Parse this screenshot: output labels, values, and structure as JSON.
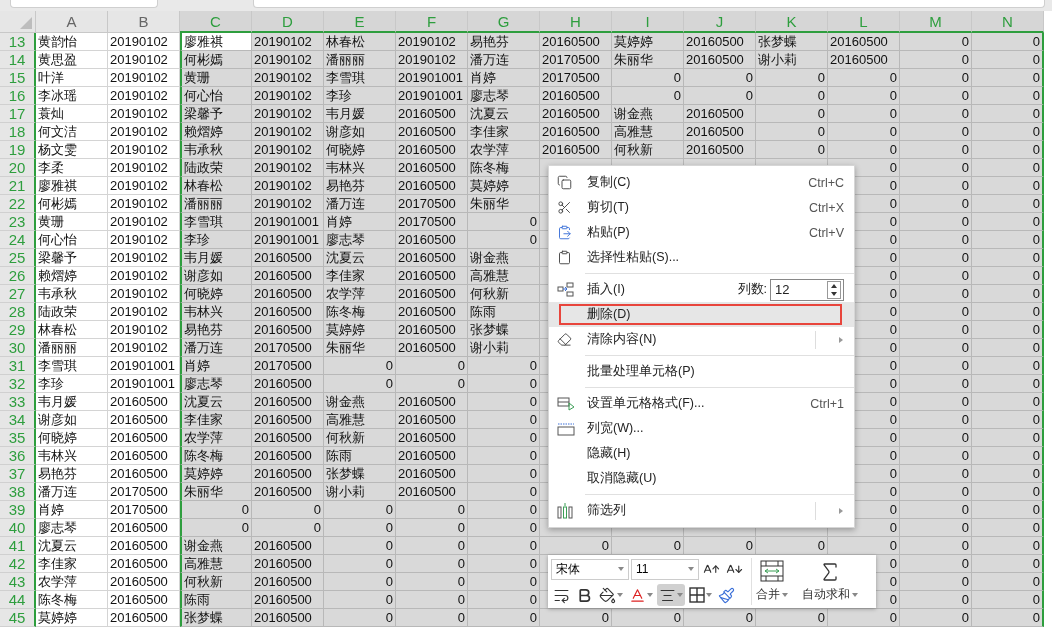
{
  "columns": [
    {
      "label": "A",
      "selected": false
    },
    {
      "label": "B",
      "selected": false
    },
    {
      "label": "C",
      "selected": true
    },
    {
      "label": "D",
      "selected": true
    },
    {
      "label": "E",
      "selected": true
    },
    {
      "label": "F",
      "selected": true
    },
    {
      "label": "G",
      "selected": true
    },
    {
      "label": "H",
      "selected": true
    },
    {
      "label": "I",
      "selected": true
    },
    {
      "label": "J",
      "selected": true
    },
    {
      "label": "K",
      "selected": true
    },
    {
      "label": "L",
      "selected": true
    },
    {
      "label": "M",
      "selected": true
    },
    {
      "label": "N",
      "selected": true
    }
  ],
  "rows": [
    {
      "n": "13",
      "cells": [
        "黄韵怡",
        "20190102",
        {
          "text": "廖雅祺",
          "active": true
        },
        "20190102",
        "林春松",
        "20190102",
        "易艳芬",
        "20160500",
        "莫婷婷",
        "20160500",
        "张梦蝶",
        "20160500",
        {
          "number": "0"
        },
        {
          "number": "0"
        }
      ]
    },
    {
      "n": "14",
      "cells": [
        "黄思盈",
        "20190102",
        "何彬嫣",
        "20190102",
        "潘丽丽",
        "20190102",
        "潘万连",
        "20170500",
        "朱丽华",
        "20160500",
        "谢小莉",
        "20160500",
        {
          "number": "0"
        },
        {
          "number": "0"
        }
      ]
    },
    {
      "n": "15",
      "cells": [
        "叶洋",
        "20190102",
        "黄珊",
        "20190102",
        "李雪琪",
        "201901001",
        "肖婷",
        "20170500",
        {
          "number": "0"
        },
        {
          "number": "0"
        },
        {
          "number": "0"
        },
        {
          "number": "0"
        },
        {
          "number": "0"
        },
        {
          "number": "0"
        }
      ]
    },
    {
      "n": "16",
      "cells": [
        "李冰瑶",
        "20190102",
        "何心怡",
        "20190102",
        "李珍",
        "201901001",
        "廖志琴",
        "20160500",
        {
          "number": "0"
        },
        {
          "number": "0"
        },
        {
          "number": "0"
        },
        {
          "number": "0"
        },
        {
          "number": "0"
        },
        {
          "number": "0"
        }
      ]
    },
    {
      "n": "17",
      "cells": [
        "蓑灿",
        "20190102",
        "梁馨予",
        "20190102",
        "韦月媛",
        "20160500",
        "沈夏云",
        "20160500",
        "谢金燕",
        "20160500",
        {
          "number": "0"
        },
        {
          "number": "0"
        },
        {
          "number": "0"
        },
        {
          "number": "0"
        }
      ]
    },
    {
      "n": "18",
      "cells": [
        "何文洁",
        "20190102",
        "赖熠婷",
        "20190102",
        "谢彦如",
        "20160500",
        "李佳家",
        "20160500",
        "高雅慧",
        "20160500",
        {
          "number": "0"
        },
        {
          "number": "0"
        },
        {
          "number": "0"
        },
        {
          "number": "0"
        }
      ]
    },
    {
      "n": "19",
      "cells": [
        "杨文雯",
        "20190102",
        "韦承秋",
        "20190102",
        "何晓婷",
        "20160500",
        "农学萍",
        "20160500",
        "何秋新",
        "20160500",
        {
          "number": "0"
        },
        {
          "number": "0"
        },
        {
          "number": "0"
        },
        {
          "number": "0"
        }
      ]
    },
    {
      "n": "20",
      "cells": [
        "李柔",
        "20190102",
        "陆政荣",
        "20190102",
        "韦林兴",
        "20160500",
        "陈冬梅",
        null,
        null,
        null,
        null,
        {
          "number": "0"
        },
        {
          "number": "0"
        },
        {
          "number": "0"
        }
      ]
    },
    {
      "n": "21",
      "cells": [
        "廖雅祺",
        "20190102",
        "林春松",
        "20190102",
        "易艳芬",
        "20160500",
        "莫婷婷",
        null,
        null,
        null,
        null,
        {
          "number": "0"
        },
        {
          "number": "0"
        },
        {
          "number": "0"
        }
      ]
    },
    {
      "n": "22",
      "cells": [
        "何彬嫣",
        "20190102",
        "潘丽丽",
        "20190102",
        "潘万连",
        "20170500",
        "朱丽华",
        null,
        null,
        null,
        null,
        {
          "number": "0"
        },
        {
          "number": "0"
        },
        {
          "number": "0"
        }
      ]
    },
    {
      "n": "23",
      "cells": [
        "黄珊",
        "20190102",
        "李雪琪",
        "201901001",
        "肖婷",
        "20170500",
        {
          "number": "0"
        },
        null,
        null,
        null,
        null,
        {
          "number": "0"
        },
        {
          "number": "0"
        },
        {
          "number": "0"
        }
      ]
    },
    {
      "n": "24",
      "cells": [
        "何心怡",
        "20190102",
        "李珍",
        "201901001",
        "廖志琴",
        "20160500",
        {
          "number": "0"
        },
        null,
        null,
        null,
        null,
        {
          "number": "0"
        },
        {
          "number": "0"
        },
        {
          "number": "0"
        }
      ]
    },
    {
      "n": "25",
      "cells": [
        "梁馨予",
        "20190102",
        "韦月媛",
        "20160500",
        "沈夏云",
        "20160500",
        "谢金燕",
        null,
        null,
        null,
        null,
        {
          "number": "0"
        },
        {
          "number": "0"
        },
        {
          "number": "0"
        }
      ]
    },
    {
      "n": "26",
      "cells": [
        "赖熠婷",
        "20190102",
        "谢彦如",
        "20160500",
        "李佳家",
        "20160500",
        "高雅慧",
        null,
        null,
        null,
        null,
        {
          "number": "0"
        },
        {
          "number": "0"
        },
        {
          "number": "0"
        }
      ]
    },
    {
      "n": "27",
      "cells": [
        "韦承秋",
        "20190102",
        "何晓婷",
        "20160500",
        "农学萍",
        "20160500",
        "何秋新",
        null,
        null,
        null,
        null,
        {
          "number": "0"
        },
        {
          "number": "0"
        },
        {
          "number": "0"
        }
      ]
    },
    {
      "n": "28",
      "cells": [
        "陆政荣",
        "20190102",
        "韦林兴",
        "20160500",
        "陈冬梅",
        "20160500",
        "陈雨",
        null,
        null,
        null,
        null,
        {
          "number": "0"
        },
        {
          "number": "0"
        },
        {
          "number": "0"
        }
      ]
    },
    {
      "n": "29",
      "cells": [
        "林春松",
        "20190102",
        "易艳芬",
        "20160500",
        "莫婷婷",
        "20160500",
        "张梦蝶",
        null,
        null,
        null,
        null,
        {
          "number": "0"
        },
        {
          "number": "0"
        },
        {
          "number": "0"
        }
      ]
    },
    {
      "n": "30",
      "cells": [
        "潘丽丽",
        "20190102",
        "潘万连",
        "20170500",
        "朱丽华",
        "20160500",
        "谢小莉",
        null,
        null,
        null,
        null,
        {
          "number": "0"
        },
        {
          "number": "0"
        },
        {
          "number": "0"
        }
      ]
    },
    {
      "n": "31",
      "cells": [
        "李雪琪",
        "201901001",
        "肖婷",
        "20170500",
        {
          "number": "0"
        },
        {
          "number": "0"
        },
        {
          "number": "0"
        },
        null,
        null,
        null,
        null,
        {
          "number": "0"
        },
        {
          "number": "0"
        },
        {
          "number": "0"
        }
      ]
    },
    {
      "n": "32",
      "cells": [
        "李珍",
        "201901001",
        "廖志琴",
        "20160500",
        {
          "number": "0"
        },
        {
          "number": "0"
        },
        {
          "number": "0"
        },
        null,
        null,
        null,
        null,
        {
          "number": "0"
        },
        {
          "number": "0"
        },
        {
          "number": "0"
        }
      ]
    },
    {
      "n": "33",
      "cells": [
        "韦月媛",
        "20160500",
        "沈夏云",
        "20160500",
        "谢金燕",
        "20160500",
        {
          "number": "0"
        },
        null,
        null,
        null,
        null,
        {
          "number": "0"
        },
        {
          "number": "0"
        },
        {
          "number": "0"
        }
      ]
    },
    {
      "n": "34",
      "cells": [
        "谢彦如",
        "20160500",
        "李佳家",
        "20160500",
        "高雅慧",
        "20160500",
        {
          "number": "0"
        },
        null,
        null,
        null,
        null,
        {
          "number": "0"
        },
        {
          "number": "0"
        },
        {
          "number": "0"
        }
      ]
    },
    {
      "n": "35",
      "cells": [
        "何晓婷",
        "20160500",
        "农学萍",
        "20160500",
        "何秋新",
        "20160500",
        {
          "number": "0"
        },
        null,
        null,
        null,
        null,
        {
          "number": "0"
        },
        {
          "number": "0"
        },
        {
          "number": "0"
        }
      ]
    },
    {
      "n": "36",
      "cells": [
        "韦林兴",
        "20160500",
        "陈冬梅",
        "20160500",
        "陈雨",
        "20160500",
        {
          "number": "0"
        },
        null,
        null,
        null,
        null,
        {
          "number": "0"
        },
        {
          "number": "0"
        },
        {
          "number": "0"
        }
      ]
    },
    {
      "n": "37",
      "cells": [
        "易艳芬",
        "20160500",
        "莫婷婷",
        "20160500",
        "张梦蝶",
        "20160500",
        {
          "number": "0"
        },
        null,
        null,
        null,
        null,
        {
          "number": "0"
        },
        {
          "number": "0"
        },
        {
          "number": "0"
        }
      ]
    },
    {
      "n": "38",
      "cells": [
        "潘万连",
        "20170500",
        "朱丽华",
        "20160500",
        "谢小莉",
        "20160500",
        {
          "number": "0"
        },
        null,
        null,
        null,
        null,
        {
          "number": "0"
        },
        {
          "number": "0"
        },
        {
          "number": "0"
        }
      ]
    },
    {
      "n": "39",
      "cells": [
        "肖婷",
        "20170500",
        {
          "number": "0"
        },
        {
          "number": "0"
        },
        {
          "number": "0"
        },
        {
          "number": "0"
        },
        {
          "number": "0"
        },
        null,
        null,
        null,
        null,
        {
          "number": "0"
        },
        {
          "number": "0"
        },
        {
          "number": "0"
        }
      ]
    },
    {
      "n": "40",
      "cells": [
        "廖志琴",
        "20160500",
        {
          "number": "0"
        },
        {
          "number": "0"
        },
        {
          "number": "0"
        },
        {
          "number": "0"
        },
        {
          "number": "0"
        },
        null,
        null,
        null,
        null,
        {
          "number": "0"
        },
        {
          "number": "0"
        },
        {
          "number": "0"
        }
      ]
    },
    {
      "n": "41",
      "cells": [
        "沈夏云",
        "20160500",
        "谢金燕",
        "20160500",
        {
          "number": "0"
        },
        {
          "number": "0"
        },
        {
          "number": "0"
        },
        {
          "number": "0"
        },
        {
          "number": "0"
        },
        {
          "number": "0"
        },
        {
          "number": "0"
        },
        {
          "number": "0"
        },
        {
          "number": "0"
        },
        {
          "number": "0"
        }
      ]
    },
    {
      "n": "42",
      "cells": [
        "李佳家",
        "20160500",
        "高雅慧",
        "20160500",
        {
          "number": "0"
        },
        {
          "number": "0"
        },
        {
          "number": "0"
        },
        null,
        null,
        null,
        null,
        {
          "number": "0"
        },
        {
          "number": "0"
        },
        {
          "number": "0"
        }
      ]
    },
    {
      "n": "43",
      "cells": [
        "农学萍",
        "20160500",
        "何秋新",
        "20160500",
        {
          "number": "0"
        },
        {
          "number": "0"
        },
        {
          "number": "0"
        },
        null,
        null,
        null,
        null,
        {
          "number": "0"
        },
        {
          "number": "0"
        },
        {
          "number": "0"
        }
      ]
    },
    {
      "n": "44",
      "cells": [
        "陈冬梅",
        "20160500",
        "陈雨",
        "20160500",
        {
          "number": "0"
        },
        {
          "number": "0"
        },
        {
          "number": "0"
        },
        null,
        null,
        null,
        null,
        {
          "number": "0"
        },
        {
          "number": "0"
        },
        {
          "number": "0"
        }
      ]
    },
    {
      "n": "45",
      "cells": [
        "莫婷婷",
        "20160500",
        "张梦蝶",
        "20160500",
        {
          "number": "0"
        },
        {
          "number": "0"
        },
        {
          "number": "0"
        },
        {
          "number": "0"
        },
        {
          "number": "0"
        },
        {
          "number": "0"
        },
        {
          "number": "0"
        },
        {
          "number": "0"
        },
        {
          "number": "0"
        },
        {
          "number": "0"
        }
      ]
    }
  ],
  "context_menu": {
    "items": [
      {
        "kind": "item",
        "label": "复制(C)",
        "shortcut": "Ctrl+C",
        "highlighted": false,
        "outlined": false
      },
      {
        "kind": "item",
        "label": "剪切(T)",
        "shortcut": "Ctrl+X",
        "highlighted": false,
        "outlined": false
      },
      {
        "kind": "item",
        "label": "粘贴(P)",
        "shortcut": "Ctrl+V",
        "highlighted": false,
        "outlined": false
      },
      {
        "kind": "item",
        "label": "选择性粘贴(S)...",
        "highlighted": false,
        "outlined": false
      },
      {
        "kind": "separator"
      },
      {
        "kind": "count",
        "label": "插入(I)",
        "count_label": "列数:",
        "count_value": "12",
        "highlighted": false,
        "outlined": false
      },
      {
        "kind": "item",
        "label": "删除(D)",
        "highlighted": true,
        "outlined": true
      },
      {
        "kind": "submenu",
        "label": "清除内容(N)",
        "highlighted": false,
        "outlined": false
      },
      {
        "kind": "separator"
      },
      {
        "kind": "item",
        "label": "批量处理单元格(P)",
        "highlighted": false,
        "outlined": false
      },
      {
        "kind": "separator"
      },
      {
        "kind": "item",
        "label": "设置单元格格式(F)...",
        "shortcut": "Ctrl+1",
        "highlighted": false,
        "outlined": false
      },
      {
        "kind": "item",
        "label": "列宽(W)...",
        "highlighted": false,
        "outlined": false
      },
      {
        "kind": "item",
        "label": "隐藏(H)",
        "highlighted": false,
        "outlined": false
      },
      {
        "kind": "item",
        "label": "取消隐藏(U)",
        "highlighted": false,
        "outlined": false
      },
      {
        "kind": "separator"
      },
      {
        "kind": "submenu",
        "label": "筛选列",
        "highlighted": false,
        "outlined": false
      }
    ]
  },
  "mini_toolbar": {
    "font": "宋体",
    "size": "11",
    "align_pressed": true,
    "merge_label": "合并",
    "sum_label": "自动求和"
  }
}
